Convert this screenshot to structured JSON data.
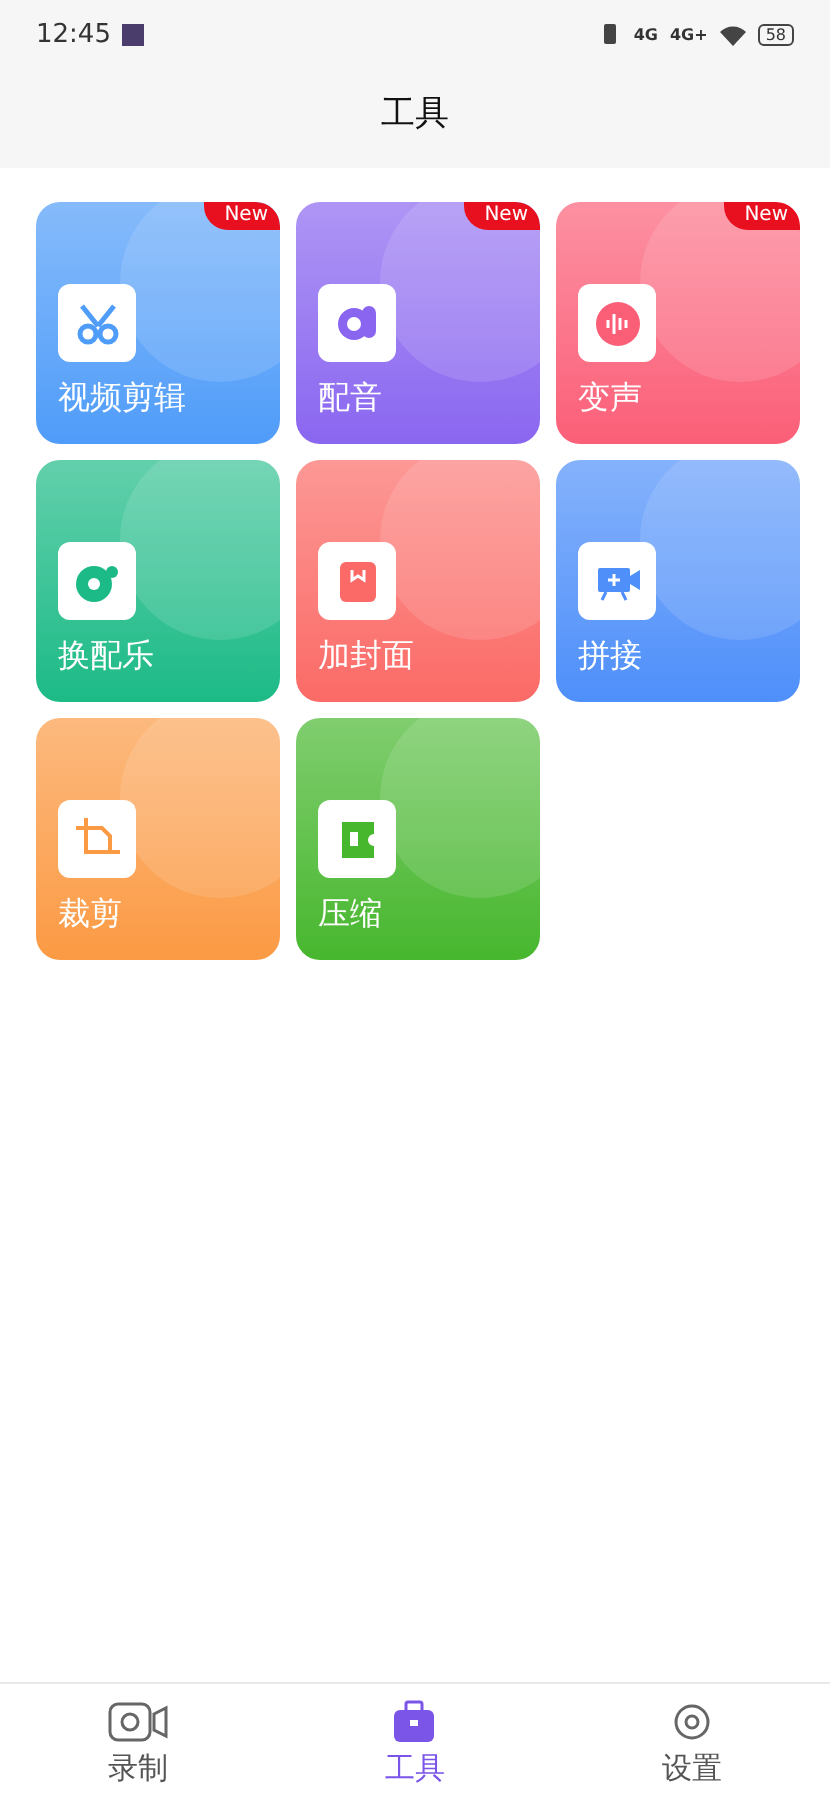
{
  "status_bar": {
    "time": "12:45",
    "network_1": "4G",
    "network_2": "4G+",
    "battery": "58"
  },
  "header": {
    "title": "工具"
  },
  "tools": [
    {
      "label": "视频剪辑",
      "new": true,
      "badge": "New",
      "color": "#4f9cf9",
      "kind": "scissors"
    },
    {
      "label": "配音",
      "new": true,
      "badge": "New",
      "color": "#8a66f0",
      "kind": "dub"
    },
    {
      "label": "变声",
      "new": true,
      "badge": "New",
      "color": "#fb5f78",
      "kind": "voice"
    },
    {
      "label": "换配乐",
      "new": false,
      "color": "#1cba86",
      "kind": "music"
    },
    {
      "label": "加封面",
      "new": false,
      "color": "#fb6a66",
      "kind": "cover"
    },
    {
      "label": "拼接",
      "new": false,
      "color": "#4e8ffa",
      "kind": "join"
    },
    {
      "label": "裁剪",
      "new": false,
      "color": "#fb9a44",
      "kind": "crop"
    },
    {
      "label": "压缩",
      "new": false,
      "color": "#47b72e",
      "kind": "compress"
    }
  ],
  "tab_bar": [
    {
      "label": "录制",
      "selected": false,
      "kind": "record"
    },
    {
      "label": "工具",
      "selected": true,
      "kind": "tools"
    },
    {
      "label": "设置",
      "selected": false,
      "kind": "settings"
    }
  ]
}
